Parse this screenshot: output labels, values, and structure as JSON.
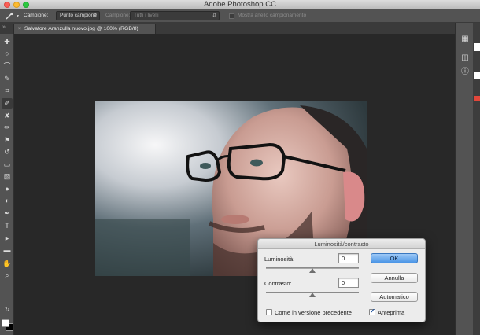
{
  "app": {
    "title": "Adobe Photoshop CC"
  },
  "options_bar": {
    "tool_icon": "eyedropper-icon",
    "sample_label": "Campione:",
    "sample_value": "Punto campione",
    "layers_label": "Campione:",
    "layers_value": "Tutti i livelli",
    "ring_label": "Mostra anello campionamento",
    "ring_checked": false
  },
  "document": {
    "tab_title": "Salvatore Aranzulla nuovo.jpg @ 100% (RGB/8)",
    "close_glyph": "×"
  },
  "toolbar": {
    "tools": [
      {
        "name": "move-tool-icon",
        "glyph": "✚"
      },
      {
        "name": "marquee-tool-icon",
        "glyph": "○"
      },
      {
        "name": "lasso-tool-icon",
        "glyph": "⌒"
      },
      {
        "name": "quick-selection-tool-icon",
        "glyph": "✎"
      },
      {
        "name": "crop-tool-icon",
        "glyph": "⌗"
      },
      {
        "name": "eyedropper-tool-icon",
        "glyph": "✐"
      },
      {
        "name": "healing-brush-tool-icon",
        "glyph": "✘"
      },
      {
        "name": "brush-tool-icon",
        "glyph": "✏"
      },
      {
        "name": "clone-stamp-tool-icon",
        "glyph": "⚑"
      },
      {
        "name": "history-brush-tool-icon",
        "glyph": "↺"
      },
      {
        "name": "eraser-tool-icon",
        "glyph": "▭"
      },
      {
        "name": "gradient-tool-icon",
        "glyph": "▧"
      },
      {
        "name": "blur-tool-icon",
        "glyph": "●"
      },
      {
        "name": "dodge-tool-icon",
        "glyph": "◐"
      },
      {
        "name": "pen-tool-icon",
        "glyph": "✒"
      },
      {
        "name": "type-tool-icon",
        "glyph": "T"
      },
      {
        "name": "path-selection-tool-icon",
        "glyph": "▸"
      },
      {
        "name": "shape-tool-icon",
        "glyph": "▬"
      },
      {
        "name": "hand-tool-icon",
        "glyph": "✋"
      },
      {
        "name": "zoom-tool-icon",
        "glyph": "⌕"
      }
    ],
    "active_tool": 5,
    "foreground_color": "#ffffff",
    "background_color": "#000000"
  },
  "dialog": {
    "title": "Luminosità/contrasto",
    "brightness_label": "Luminosità:",
    "brightness_value": "0",
    "brightness_fraction": 0.5,
    "contrast_label": "Contrasto:",
    "contrast_value": "0",
    "contrast_fraction": 0.5,
    "ok_label": "OK",
    "cancel_label": "Annulla",
    "auto_label": "Automatico",
    "legacy_label": "Come in versione precedente",
    "legacy_checked": false,
    "preview_label": "Anteprima",
    "preview_checked": true
  },
  "colors": {
    "accent": "#4a95e6"
  }
}
